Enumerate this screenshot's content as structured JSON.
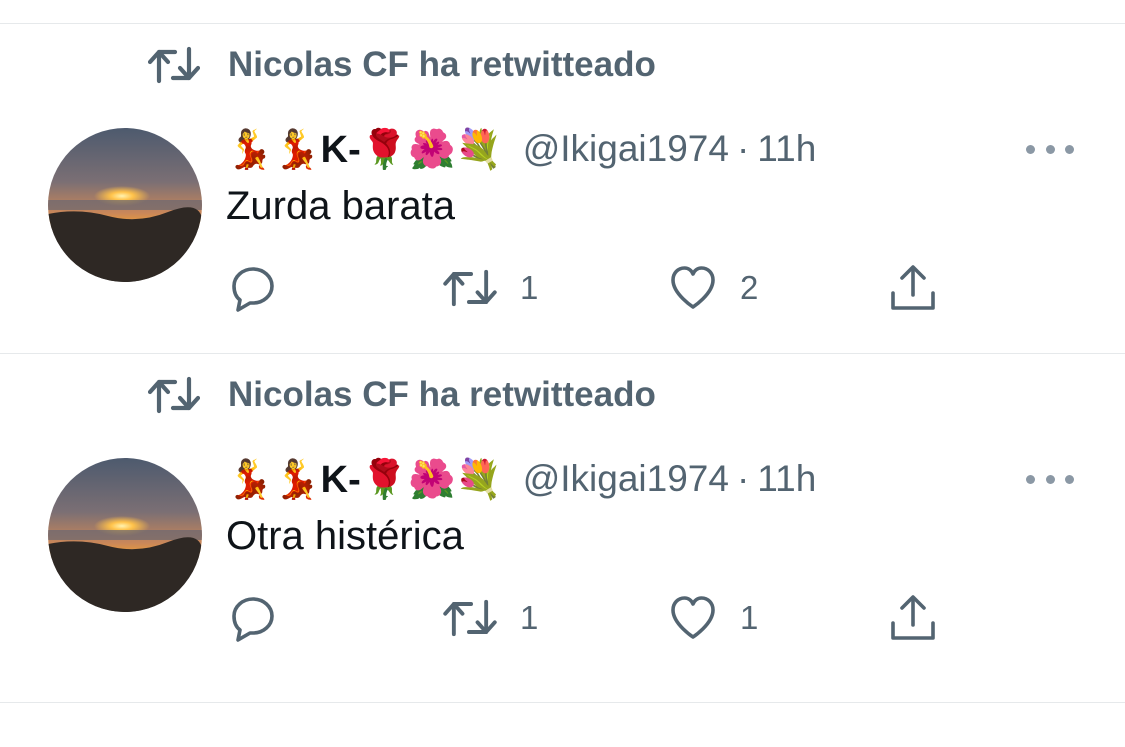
{
  "tweets": [
    {
      "retweeted_by": "Nicolas CF ha retwitteado",
      "author_emoji": "💃💃",
      "author_name": "K-",
      "author_flowers": "🌹🌺💐",
      "handle": "@Ikigai1974",
      "separator": "·",
      "time": "11h",
      "text": "Zurda barata",
      "reply_count": "",
      "retweet_count": "1",
      "like_count": "2",
      "avatar_icon": "sunset-avatar"
    },
    {
      "retweeted_by": "Nicolas CF ha retwitteado",
      "author_emoji": "💃💃",
      "author_name": "K-",
      "author_flowers": "🌹🌺💐",
      "handle": "@Ikigai1974",
      "separator": "·",
      "time": "11h",
      "text": "Otra histérica",
      "reply_count": "",
      "retweet_count": "1",
      "like_count": "1",
      "avatar_icon": "sunset-avatar"
    }
  ],
  "icons": {
    "retweet": "retweet-icon",
    "reply": "reply-icon",
    "like": "heart-icon",
    "share": "share-icon",
    "more": "more-options-icon"
  },
  "colors": {
    "secondary_text": "#536471",
    "primary_text": "#0f1419",
    "divider": "#e6e9eb"
  }
}
